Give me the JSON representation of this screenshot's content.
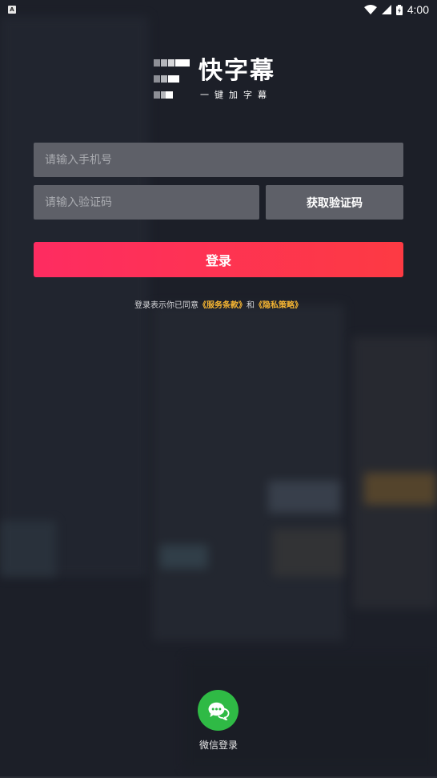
{
  "status_bar": {
    "notification_icon": "a-icon",
    "time": "4:00",
    "icons": [
      "wifi-icon",
      "cellular-icon",
      "battery-icon"
    ]
  },
  "logo": {
    "title": "快字幕",
    "subtitle": "一键加字幕"
  },
  "form": {
    "phone_placeholder": "请输入手机号",
    "code_placeholder": "请输入验证码",
    "get_code_label": "获取验证码",
    "login_label": "登录"
  },
  "agreement": {
    "prefix": "登录表示你已同意",
    "terms": "《服务条款》",
    "conjunction": "和",
    "privacy": "《隐私策略》"
  },
  "wechat": {
    "icon": "wechat-icon",
    "label": "微信登录"
  },
  "colors": {
    "background": "#1c1f28",
    "field": "#5e6068",
    "login_gradient_start": "#fe2c61",
    "login_gradient_end": "#fd3a43",
    "link": "#f4b432",
    "wechat": "#2fba45"
  }
}
